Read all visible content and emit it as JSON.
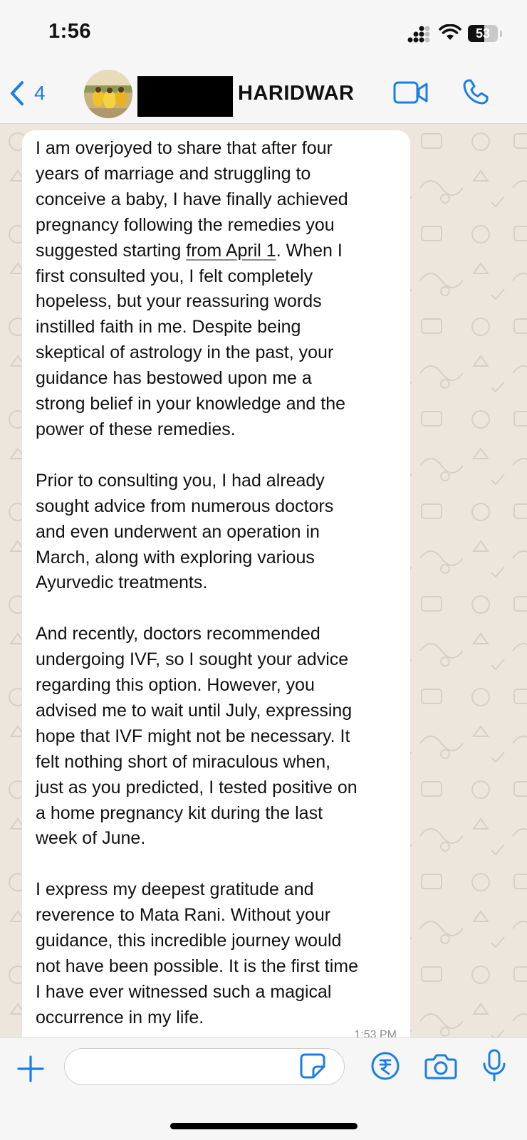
{
  "status_bar": {
    "time": "1:56",
    "battery": "53"
  },
  "header": {
    "back_count": "4",
    "contact_name": "HARIDWAR"
  },
  "message": {
    "before_link": "I am overjoyed to share that after four\nyears of marriage and struggling to\nconceive a baby, I have finally achieved\npregnancy following the remedies you\nsuggested starting ",
    "link": "from April 1",
    "after_link": ". When I\nfirst consulted you, I felt completely\nhopeless, but your reassuring words\ninstilled faith in me. Despite being\nskeptical of astrology in the past, your\nguidance has bestowed upon me a\nstrong belief in your knowledge and the\npower of these remedies.\n\nPrior to consulting you, I had already\nsought advice from numerous doctors\nand even underwent an operation in\nMarch, along with exploring various\nAyurvedic treatments.\n\nAnd recently, doctors recommended\nundergoing IVF, so I sought your advice\nregarding this option. However, you\nadvised me to wait until July, expressing\nhope that IVF might not be necessary. It\nfelt nothing short of miraculous when,\njust as you predicted, I tested positive on\na home pregnancy kit during the last\nweek of June.\n\nI express my deepest gratitude and\nreverence to Mata Rani. Without your\nguidance, this incredible journey would\nnot have been possible. It is the first time\nI have ever witnessed such a magical\noccurrence in my life.",
    "time": "1:53 PM"
  },
  "input_bar": {
    "placeholder": ""
  },
  "colors": {
    "accent": "#1a7ee8",
    "chat_background": "#ece6dd",
    "bubble": "#ffffff"
  }
}
